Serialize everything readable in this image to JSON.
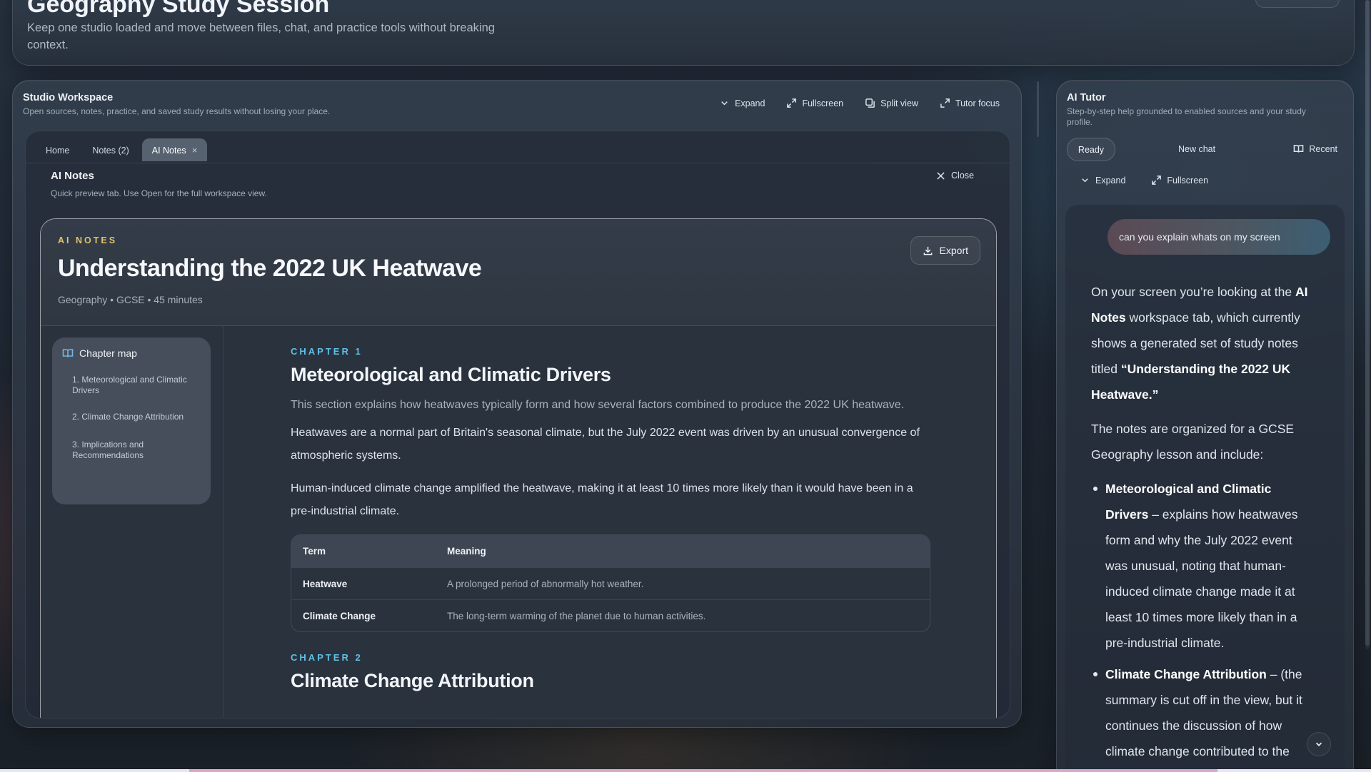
{
  "header": {
    "title": "Geography Study Session",
    "subtitle": "Keep one studio loaded and move between files, chat, and practice tools without breaking context."
  },
  "studio": {
    "title": "Studio Workspace",
    "subtitle": "Open sources, notes, practice, and saved study results without losing your place.",
    "toolbar": {
      "expand": "Expand",
      "fullscreen": "Fullscreen",
      "split": "Split view",
      "tutor_focus": "Tutor focus"
    },
    "tabs": {
      "home": "Home",
      "notes": "Notes (2)",
      "ai_notes": "AI Notes",
      "close_x": "×"
    },
    "preview": {
      "title": "AI Notes",
      "subtitle": "Quick preview tab. Use Open for the full workspace view.",
      "close": "Close"
    }
  },
  "notes": {
    "eyebrow": "AI NOTES",
    "title": "Understanding the 2022 UK Heatwave",
    "meta": "Geography • GCSE • 45 minutes",
    "export": "Export",
    "chapter_map": {
      "title": "Chapter map",
      "items": [
        "1. Meteorological and Climatic Drivers",
        "2. Climate Change Attribution",
        "3. Implications and Recommendations"
      ]
    },
    "chapter1": {
      "label": "CHAPTER 1",
      "title": "Meteorological and Climatic Drivers",
      "intro": "This section explains how heatwaves typically form and how several factors combined to produce the 2022 UK heatwave.",
      "para1": "Heatwaves are a normal part of Britain's seasonal climate, but the July 2022 event was driven by an unusual convergence of atmospheric systems.",
      "para2": "Human-induced climate change amplified the heatwave, making it at least 10 times more likely than it would have been in a pre-industrial climate."
    },
    "table": {
      "headers": [
        "Term",
        "Meaning"
      ],
      "rows": [
        [
          "Heatwave",
          "A prolonged period of abnormally hot weather."
        ],
        [
          "Climate Change",
          "The long-term warming of the planet due to human activities."
        ]
      ]
    },
    "chapter2": {
      "label": "CHAPTER 2",
      "title": "Climate Change Attribution"
    }
  },
  "tutor": {
    "title": "AI Tutor",
    "subtitle": "Step-by-step help grounded to enabled sources and your study profile.",
    "ready": "Ready",
    "new_chat": "New chat",
    "recent": "Recent",
    "expand": "Expand",
    "fullscreen": "Fullscreen",
    "user_message": "can you explain whats on my screen",
    "reply": {
      "p1_a": "On your screen you’re looking at the ",
      "p1_b": "AI Notes",
      "p1_c": " workspace tab, which currently shows a generated set of study notes titled ",
      "p1_d": "“Understanding the 2022 UK Heatwave.”",
      "p2": "The notes are organized for a GCSE Geography lesson and include:",
      "b1_title": "Meteorological and Climatic Drivers",
      "b1_text": " – explains how heatwaves form and why the July 2022 event was unusual, noting that human-induced climate change made it at least 10 times more likely than in a pre-industrial climate.",
      "b2_title": "Climate Change Attribution",
      "b2_text": " – (the summary is cut off in the view, but it continues the discussion of how climate change contributed to the"
    }
  },
  "icons": {
    "expand": "chevron-down-icon",
    "fullscreen": "fullscreen-icon",
    "split": "split-view-icon",
    "tutor_focus": "tutor-focus-icon",
    "export": "download-icon",
    "chapter_map": "book-icon",
    "recent": "book-icon",
    "close": "close-icon",
    "scroll_down": "chevron-down-icon"
  },
  "colors": {
    "eyebrow": "#e0c26d",
    "chapter_label": "#5fc0e6",
    "book_icon": "#74b6e8"
  }
}
